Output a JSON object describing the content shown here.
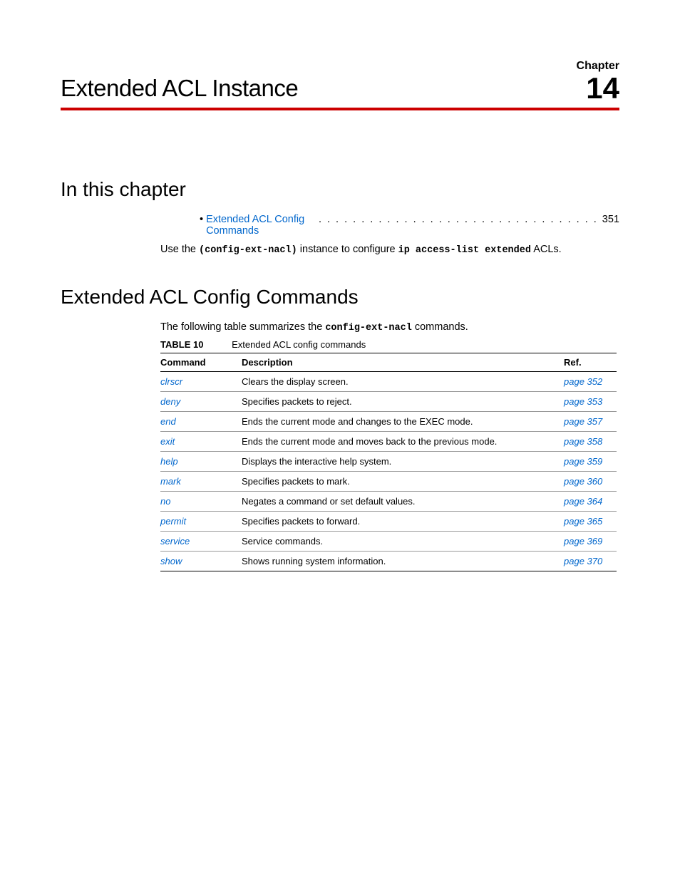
{
  "chapter": {
    "label": "Chapter",
    "number": "14",
    "title": "Extended ACL Instance"
  },
  "in_this_chapter": {
    "heading": "In this chapter",
    "toc": {
      "bullet": "•",
      "link_text": "Extended ACL Config Commands",
      "dots": ". . . . . . . . . . . . . . . . . . . . . . . . . . . . . . . . .",
      "page": "351"
    },
    "use_line": {
      "prefix": "Use the",
      "code1": "(config-ext-nacl)",
      "mid": " instance to configure ",
      "code2": "ip access-list extended",
      "suffix": " ACLs."
    }
  },
  "config_commands": {
    "heading": "Extended ACL Config Commands",
    "intro_prefix": "The following table summarizes the ",
    "intro_code": "config-ext-nacl",
    "intro_suffix": " commands.",
    "table_label": "TABLE 10",
    "table_caption": "Extended ACL config commands",
    "columns": {
      "command": "Command",
      "description": "Description",
      "ref": "Ref."
    },
    "rows": [
      {
        "cmd": "clrscr",
        "desc": "Clears the display screen.",
        "ref": "page 352"
      },
      {
        "cmd": "deny",
        "desc": "Specifies packets to reject.",
        "ref": "page 353"
      },
      {
        "cmd": "end",
        "desc": "Ends the current mode and changes to the EXEC mode.",
        "ref": "page 357"
      },
      {
        "cmd": "exit",
        "desc": "Ends the current mode and moves back to the previous mode.",
        "ref": "page 358"
      },
      {
        "cmd": "help",
        "desc": "Displays the interactive help system.",
        "ref": "page 359"
      },
      {
        "cmd": "mark",
        "desc": "Specifies packets to mark.",
        "ref": "page 360"
      },
      {
        "cmd": "no",
        "desc": "Negates a command or set default values.",
        "ref": "page 364"
      },
      {
        "cmd": "permit",
        "desc": "Specifies packets to forward.",
        "ref": "page 365"
      },
      {
        "cmd": "service",
        "desc": "Service commands.",
        "ref": "page 369"
      },
      {
        "cmd": "show",
        "desc": "Shows running system information.",
        "ref": "page 370"
      }
    ]
  }
}
